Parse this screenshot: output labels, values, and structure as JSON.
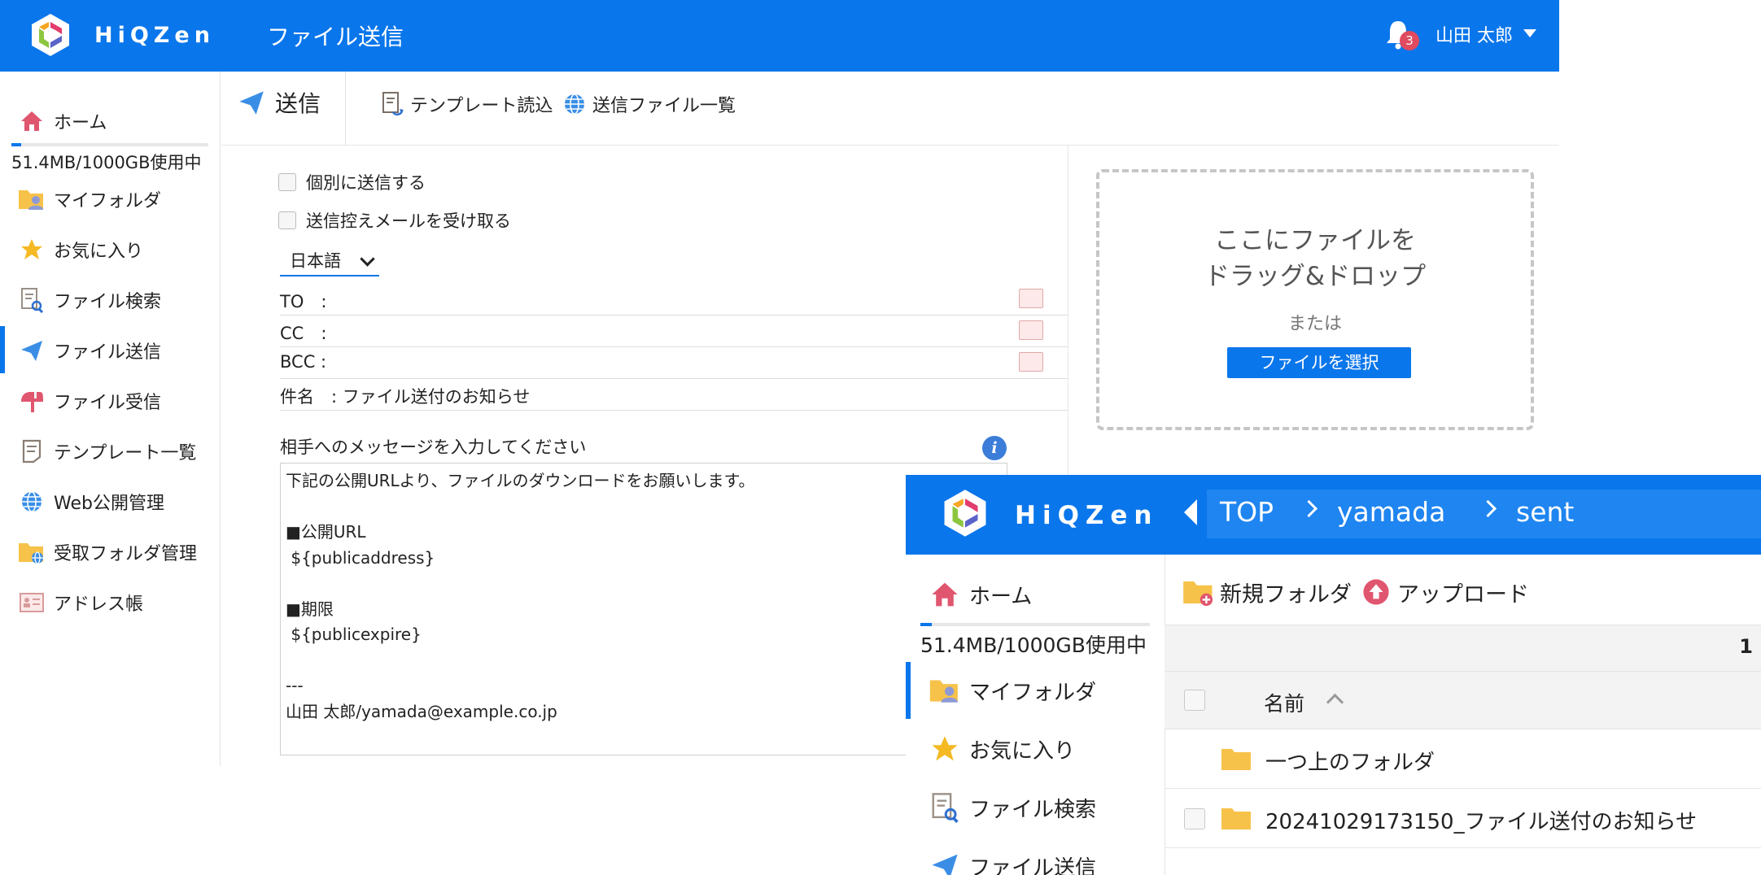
{
  "colors": {
    "brand_blue": "#0a76eb",
    "badge_red": "#e04a5f",
    "folder_yellow": "#f7c24a",
    "home_red": "#e0566f"
  },
  "app": {
    "brand": "HiQZen",
    "page_title": "ファイル送信"
  },
  "header": {
    "notification_count": "3",
    "user_name": "山田 太郎"
  },
  "sidebar": {
    "home": "ホーム",
    "usage": "51.4MB/1000GB使用中",
    "usage_fraction": 0.05,
    "items": [
      {
        "label": "マイフォルダ",
        "icon": "my-folder-icon"
      },
      {
        "label": "お気に入り",
        "icon": "star-icon"
      },
      {
        "label": "ファイル検索",
        "icon": "file-search-icon"
      },
      {
        "label": "ファイル送信",
        "icon": "send-icon",
        "active": true
      },
      {
        "label": "ファイル受信",
        "icon": "mailbox-icon"
      },
      {
        "label": "テンプレート一覧",
        "icon": "template-icon"
      },
      {
        "label": "Web公開管理",
        "icon": "globe-icon"
      },
      {
        "label": "受取フォルダ管理",
        "icon": "receive-folder-icon"
      },
      {
        "label": "アドレス帳",
        "icon": "address-book-icon"
      }
    ]
  },
  "toolbar": {
    "send_label": "送信",
    "template_load": "テンプレート読込",
    "sent_list": "送信ファイル一覧"
  },
  "form": {
    "individual_send": "個別に送信する",
    "copy_mail": "送信控えメールを受け取る",
    "language": "日本語",
    "to_label": "TO　:",
    "cc_label": "CC　:",
    "bcc_label": "BCC :",
    "subject_label": "件名　: ファイル送付のお知らせ",
    "message_label": "相手へのメッセージを入力してください",
    "message": "下記の公開URLより、ファイルのダウンロードをお願いします。\n\n■公開URL\n ${publicaddress}\n\n■期限\n ${publicexpire}\n\n---\n山田 太郎/yamada@example.co.jp"
  },
  "dropzone": {
    "line1": "ここにファイルを",
    "line2": "ドラッグ&ドロップ",
    "or": "または",
    "button": "ファイルを選択"
  },
  "browser": {
    "brand": "HiQZen",
    "breadcrumb": [
      "TOP",
      "yamada",
      "sent"
    ],
    "sidebar": {
      "home": "ホーム",
      "usage": "51.4MB/1000GB使用中",
      "items": [
        "マイフォルダ",
        "お気に入り",
        "ファイル検索",
        "ファイル送信"
      ]
    },
    "toolbar": {
      "new_folder": "新規フォルダ",
      "upload": "アップロード"
    },
    "page": "1",
    "column_name": "名前",
    "rows": [
      "一つ上のフォルダ",
      "20241029173150_ファイル送付のお知らせ"
    ]
  }
}
